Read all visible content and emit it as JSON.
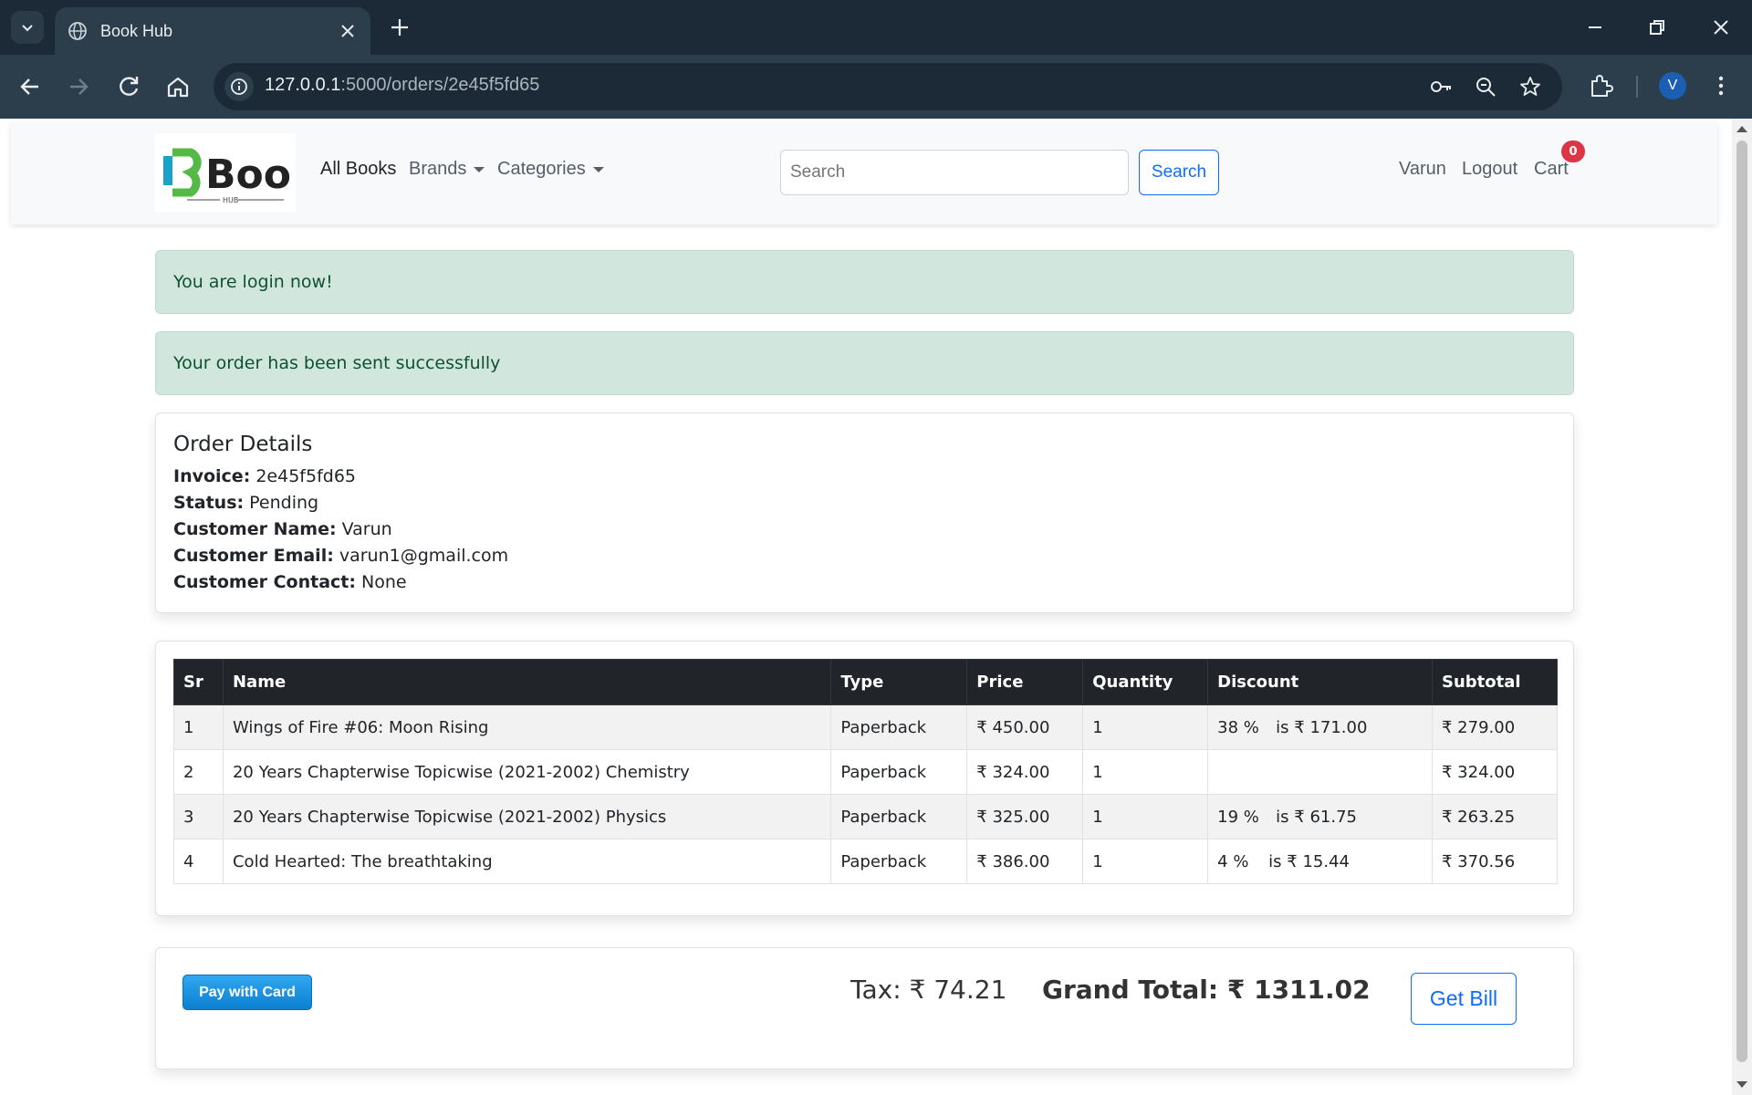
{
  "browser": {
    "tab_title": "Book Hub",
    "url_host": "127.0.0.1",
    "url_rest": ":5000/orders/2e45f5fd65",
    "profile_initial": "V"
  },
  "site_nav": {
    "logo_text": "Book",
    "logo_sub": "HUB",
    "links": {
      "all_books": "All Books",
      "brands": "Brands",
      "categories": "Categories"
    },
    "search_placeholder": "Search",
    "search_button": "Search",
    "user_name": "Varun",
    "logout": "Logout",
    "cart": "Cart",
    "cart_count": "0"
  },
  "alerts": [
    "You are login now!",
    "Your order has been sent successfully"
  ],
  "order": {
    "heading": "Order Details",
    "fields": [
      {
        "label": "Invoice:",
        "value": "2e45f5fd65"
      },
      {
        "label": "Status:",
        "value": "Pending"
      },
      {
        "label": "Customer Name:",
        "value": "Varun"
      },
      {
        "label": "Customer Email:",
        "value": "varun1@gmail.com"
      },
      {
        "label": "Customer Contact:",
        "value": "None"
      }
    ]
  },
  "table": {
    "headers": [
      "Sr",
      "Name",
      "Type",
      "Price",
      "Quantity",
      "Discount",
      "Subtotal"
    ],
    "rows": [
      {
        "sr": "1",
        "name": "Wings of Fire #06: Moon Rising",
        "type": "Paperback",
        "price": "₹ 450.00",
        "qty": "1",
        "disc_pct": "38 %",
        "disc_amt": "is ₹ 171.00",
        "subtotal": "₹ 279.00"
      },
      {
        "sr": "2",
        "name": "20 Years Chapterwise Topicwise (2021-2002) Chemistry",
        "type": "Paperback",
        "price": "₹ 324.00",
        "qty": "1",
        "disc_pct": "",
        "disc_amt": "",
        "subtotal": "₹ 324.00"
      },
      {
        "sr": "3",
        "name": "20 Years Chapterwise Topicwise (2021-2002) Physics",
        "type": "Paperback",
        "price": "₹ 325.00",
        "qty": "1",
        "disc_pct": "19 %",
        "disc_amt": "is ₹ 61.75",
        "subtotal": "₹ 263.25"
      },
      {
        "sr": "4",
        "name": "Cold Hearted: The breathtaking",
        "type": "Paperback",
        "price": "₹ 386.00",
        "qty": "1",
        "disc_pct": "4 %",
        "disc_amt": "is ₹ 15.44",
        "subtotal": "₹ 370.56"
      }
    ]
  },
  "totals": {
    "pay_button": "Pay with Card",
    "tax": "Tax: ₹ 74.21",
    "grand_total": "Grand Total: ₹ 1311.02",
    "bill_button": "Get Bill"
  },
  "colors": {
    "chrome_dark": "#1b2a36",
    "chrome_toolbar": "#2c3e4c",
    "alert_success_bg": "#d1e7dd",
    "alert_success_text": "#0f5132",
    "primary": "#0d6efd",
    "badge_danger": "#dc3545",
    "table_header": "#212529"
  }
}
